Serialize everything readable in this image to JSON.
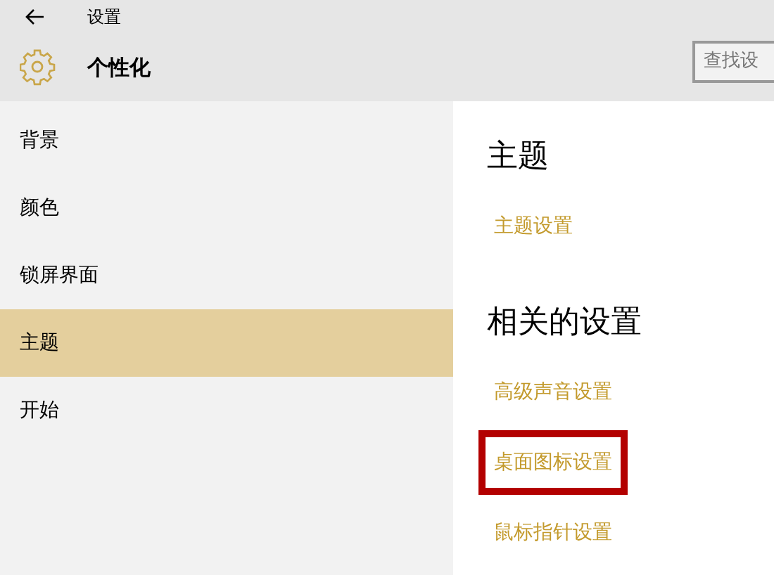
{
  "window": {
    "title": "设置"
  },
  "header": {
    "title": "个性化",
    "search": {
      "placeholder": "查找设"
    }
  },
  "sidebar": {
    "items": [
      {
        "label": "背景",
        "selected": false
      },
      {
        "label": "颜色",
        "selected": false
      },
      {
        "label": "锁屏界面",
        "selected": false
      },
      {
        "label": "主题",
        "selected": true
      },
      {
        "label": "开始",
        "selected": false
      }
    ]
  },
  "content": {
    "sections": [
      {
        "heading": "主题",
        "links": [
          {
            "label": "主题设置",
            "highlighted": false
          }
        ]
      },
      {
        "heading": "相关的设置",
        "links": [
          {
            "label": "高级声音设置",
            "highlighted": false
          },
          {
            "label": "桌面图标设置",
            "highlighted": true
          },
          {
            "label": "鼠标指针设置",
            "highlighted": false
          }
        ]
      }
    ]
  }
}
